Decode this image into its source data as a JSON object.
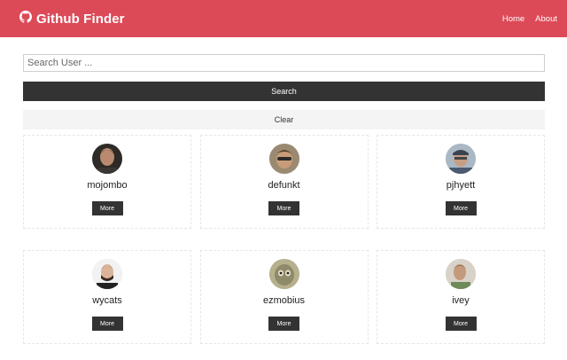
{
  "navbar": {
    "title": "Github Finder",
    "links": [
      {
        "label": "Home"
      },
      {
        "label": "About"
      }
    ],
    "bg_color": "#dc4a58"
  },
  "search": {
    "placeholder": "Search User ...",
    "value": "",
    "search_label": "Search",
    "clear_label": "Clear"
  },
  "users": [
    {
      "login": "mojombo",
      "more_label": "More"
    },
    {
      "login": "defunkt",
      "more_label": "More"
    },
    {
      "login": "pjhyett",
      "more_label": "More"
    },
    {
      "login": "wycats",
      "more_label": "More"
    },
    {
      "login": "ezmobius",
      "more_label": "More"
    },
    {
      "login": "ivey",
      "more_label": "More"
    }
  ]
}
